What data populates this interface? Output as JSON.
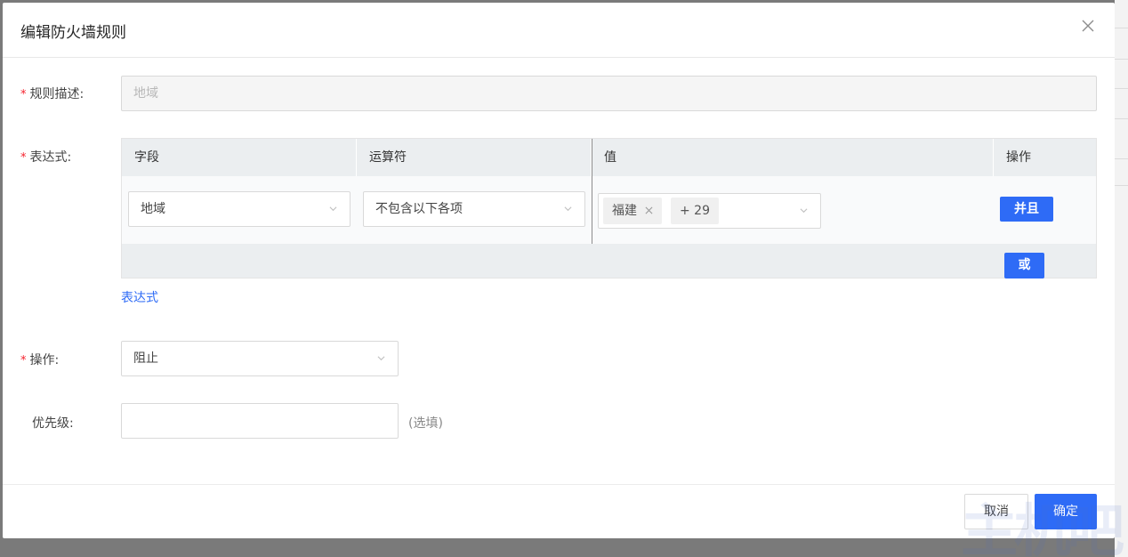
{
  "dialog": {
    "title": "编辑防火墙规则"
  },
  "form": {
    "description": {
      "label": "规则描述:",
      "value": "地域"
    },
    "expression": {
      "label": "表达式:",
      "columns": [
        "字段",
        "运算符",
        "值",
        "操作"
      ],
      "row": {
        "field": "地域",
        "operator": "不包含以下各项",
        "value_tag": "福建",
        "value_more": "+ 29",
        "and_button": "并且"
      },
      "or_button": "或",
      "edit_link": "表达式"
    },
    "action": {
      "label": "操作:",
      "value": "阻止"
    },
    "priority": {
      "label": "优先级:",
      "value": "",
      "hint": "(选填)"
    },
    "required_mark": "*"
  },
  "footer": {
    "cancel": "取消",
    "confirm": "确定"
  },
  "watermark": "主机吧",
  "colors": {
    "primary": "#2e6bf6",
    "required": "#f5222d",
    "table_header": "#ebeef0"
  },
  "icons": {
    "close": "close-icon",
    "dropdown": "chevron-down-icon",
    "tag_remove": "close-icon"
  }
}
